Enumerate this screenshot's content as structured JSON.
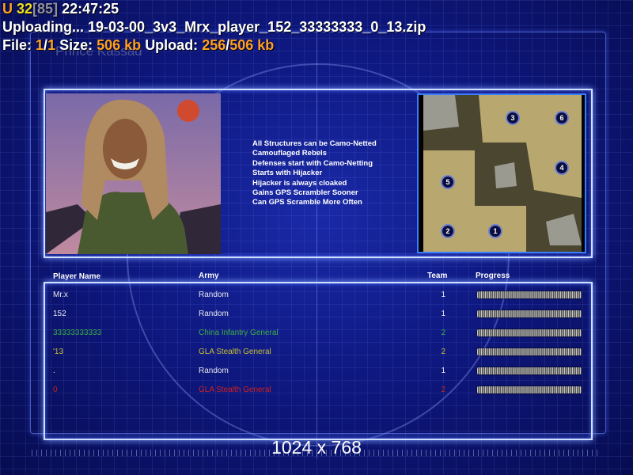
{
  "status": {
    "prefix": "U",
    "count": "32",
    "bracket_count": "[85]",
    "time": "22:47:25",
    "uploading_label": "Uploading...",
    "filename": "19-03-00_3v3_Mrx_player_152_33333333_0_13.zip",
    "file_label": "File:",
    "file_current": "1",
    "file_sep": "/",
    "file_total": "1",
    "size_label": "Size:",
    "size_value": "506 kb",
    "upload_label": "Upload:",
    "upload_done": "256",
    "upload_sep": "/",
    "upload_total": "506 kb"
  },
  "background_title": "Prince Kassad",
  "general_traits": [
    "All Structures can be Camo-Netted",
    "Camouflaged Rebels",
    "Defenses start with Camo-Netting",
    "Starts with Hijacker",
    "Hijacker is always cloaked",
    "Gains GPS Scrambler Sooner",
    "Can GPS Scramble More Often"
  ],
  "map": {
    "start_positions": [
      "1",
      "2",
      "3",
      "4",
      "5",
      "6"
    ]
  },
  "table": {
    "headers": {
      "name": "Player Name",
      "army": "Army",
      "team": "Team",
      "progress": "Progress"
    },
    "rows": [
      {
        "name": "Mr.x",
        "army": "Random",
        "team": "1",
        "color": "#e8e8f0",
        "progress": 1.0
      },
      {
        "name": "152",
        "army": "Random",
        "team": "1",
        "color": "#e8e8f0",
        "progress": 1.0
      },
      {
        "name": "33333333333",
        "army": "China Infantry General",
        "team": "2",
        "color": "#3cb040",
        "progress": 1.0
      },
      {
        "name": "'13",
        "army": "GLA Stealth General",
        "team": "2",
        "color": "#c8c030",
        "progress": 1.0
      },
      {
        "name": ".",
        "army": "Random",
        "team": "1",
        "color": "#e8e8f0",
        "progress": 1.0
      },
      {
        "name": "0",
        "army": "GLA Stealth General",
        "team": "2",
        "color": "#d02020",
        "progress": 1.0
      }
    ]
  },
  "resolution": "1024 x 768"
}
